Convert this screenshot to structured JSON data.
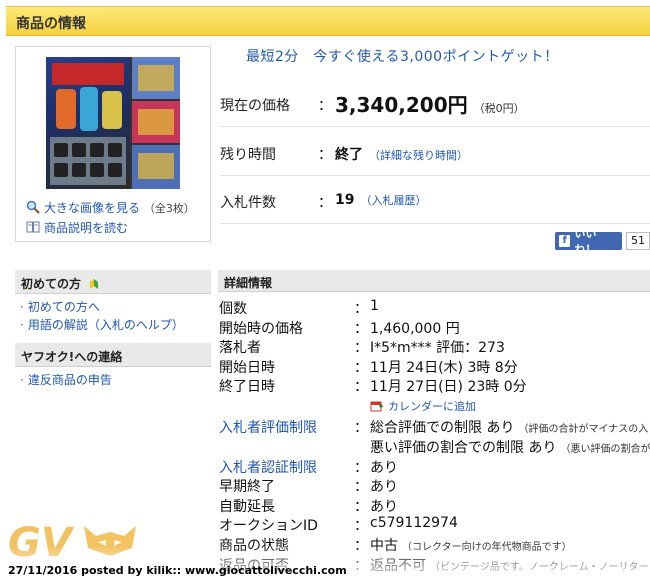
{
  "header": {
    "title": "商品の情報"
  },
  "thumbnail": {
    "enlarge_link": "大きな画像を見る",
    "enlarge_count": "（全3枚）",
    "description_link": "商品説明を読む"
  },
  "points": {
    "text": "最短2分　今すぐ使える3,000ポイントゲット！"
  },
  "price": {
    "label": "現在の価格",
    "value": "3,340,200円",
    "tax": "（税0円）"
  },
  "remaining": {
    "label": "残り時間",
    "value": "終了",
    "link": "（詳細な残り時間）"
  },
  "bids": {
    "label": "入札件数",
    "value": "19",
    "link": "（入札履歴）"
  },
  "facebook": {
    "label": "いいね！",
    "count": "51"
  },
  "sidebar": {
    "beginner_head": "初めての方",
    "beginner_items": [
      "初めての方へ",
      "用語の解説（入札のヘルプ）"
    ],
    "contact_head": "ヤフオク!への連絡",
    "contact_items": [
      "違反商品の申告"
    ]
  },
  "details": {
    "head": "詳細情報",
    "rows": [
      {
        "label": "個数",
        "value": "1"
      },
      {
        "label": "開始時の価格",
        "value": "1,460,000 円"
      },
      {
        "label": "落札者",
        "value": "I*5*m***  評価：273"
      },
      {
        "label": "開始日時",
        "value": "11月 24日(木) 3時 8分"
      },
      {
        "label": "終了日時",
        "value": "11月 27日(日) 23時 0分"
      },
      {
        "label": "入札者評価制限",
        "value": "総合評価での制限 あり",
        "note": "（評価の合計がマイナスの入"
      },
      {
        "label": "",
        "value": "悪い評価の割合での制限 あり",
        "note": "（悪い評価の割合が"
      },
      {
        "label": "入札者認証制限",
        "value": "あり"
      },
      {
        "label": "早期終了",
        "value": "あり"
      },
      {
        "label": "自動延長",
        "value": "あり"
      },
      {
        "label": "オークションID",
        "value": "c579112974"
      },
      {
        "label": "商品の状態",
        "value": "中古",
        "note": "（コレクター向けの年代物商品です）"
      },
      {
        "label": "返品の可否",
        "value": "返品不可",
        "note": "（ビンテージ品です。ノークレーム・ノーリター"
      }
    ],
    "calendar_link": "カレンダーに追加"
  },
  "watermark": {
    "logo_text": "GV",
    "footer": "27/11/2016 posted by kilik:: www.giocattolivecchi.com"
  },
  "colors": {
    "header_yellow": "#f6d23e",
    "link_blue": "#1f56b4",
    "fb_blue": "#4267b2"
  }
}
